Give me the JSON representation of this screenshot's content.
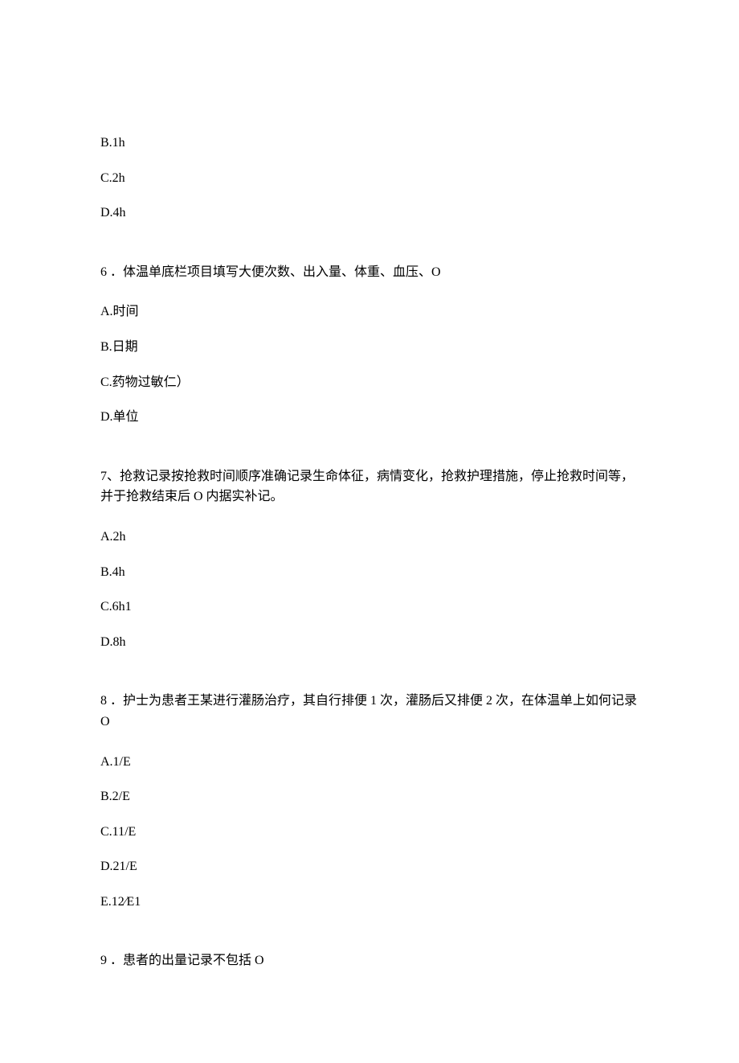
{
  "partial_options_top": [
    "B.1h",
    "C.2h",
    "D.4h"
  ],
  "questions": [
    {
      "number": "6",
      "text": "．体温单底栏项目填写大便次数、出入量、体重、血压、O",
      "options": [
        "A.时间",
        "B.日期",
        "C.药物过敏仁）",
        "D.单位"
      ]
    },
    {
      "number": "7",
      "text": "、抢救记录按抢救时间顺序准确记录生命体征，病情变化，抢救护理措施，停止抢救时间等，并于抢救结束后 O 内据实补记。",
      "options": [
        "A.2h",
        "B.4h",
        "C.6h1",
        "D.8h"
      ]
    },
    {
      "number": "8",
      "text": "．护士为患者王某进行灌肠治疗，其自行排便 1 次，灌肠后又排便 2 次，在体温单上如何记录 O",
      "options": [
        "A.1/E",
        "B.2/E",
        "C.11/E",
        "D.21/E",
        "E.12∕E1"
      ]
    },
    {
      "number": "9",
      "text": "．患者的出量记录不包括 O",
      "options": []
    }
  ]
}
